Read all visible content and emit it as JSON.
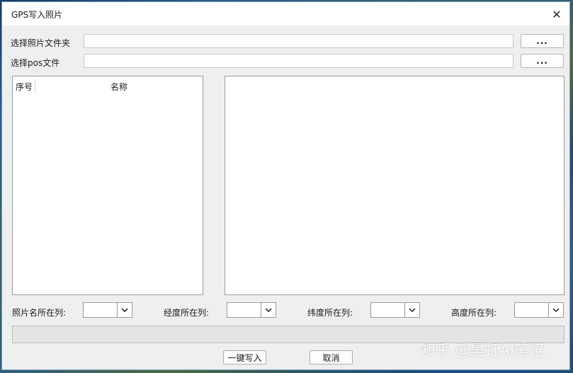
{
  "window": {
    "title": "GPS写入照片",
    "close_glyph": "✕"
  },
  "inputs": {
    "photo_folder": {
      "label": "选择照片文件夹",
      "value": "",
      "browse_label": "..."
    },
    "pos_file": {
      "label": "选择pos文件",
      "value": "",
      "browse_label": "..."
    }
  },
  "photo_list": {
    "columns": [
      "序号",
      "名称"
    ],
    "rows": []
  },
  "column_selectors": [
    {
      "label": "照片名所在列:",
      "value": ""
    },
    {
      "label": "经度所在列:",
      "value": ""
    },
    {
      "label": "纬度所在列:",
      "value": ""
    },
    {
      "label": "高度所在列:",
      "value": ""
    }
  ],
  "progress": {
    "fraction": 0,
    "fill_color": "#06b025"
  },
  "buttons": {
    "write": "一键写入",
    "cancel": "取消"
  },
  "watermark": "知乎 @昊虹AI笔记",
  "icons": {
    "close": "close-icon",
    "dropdown": "chevron-down-icon"
  }
}
